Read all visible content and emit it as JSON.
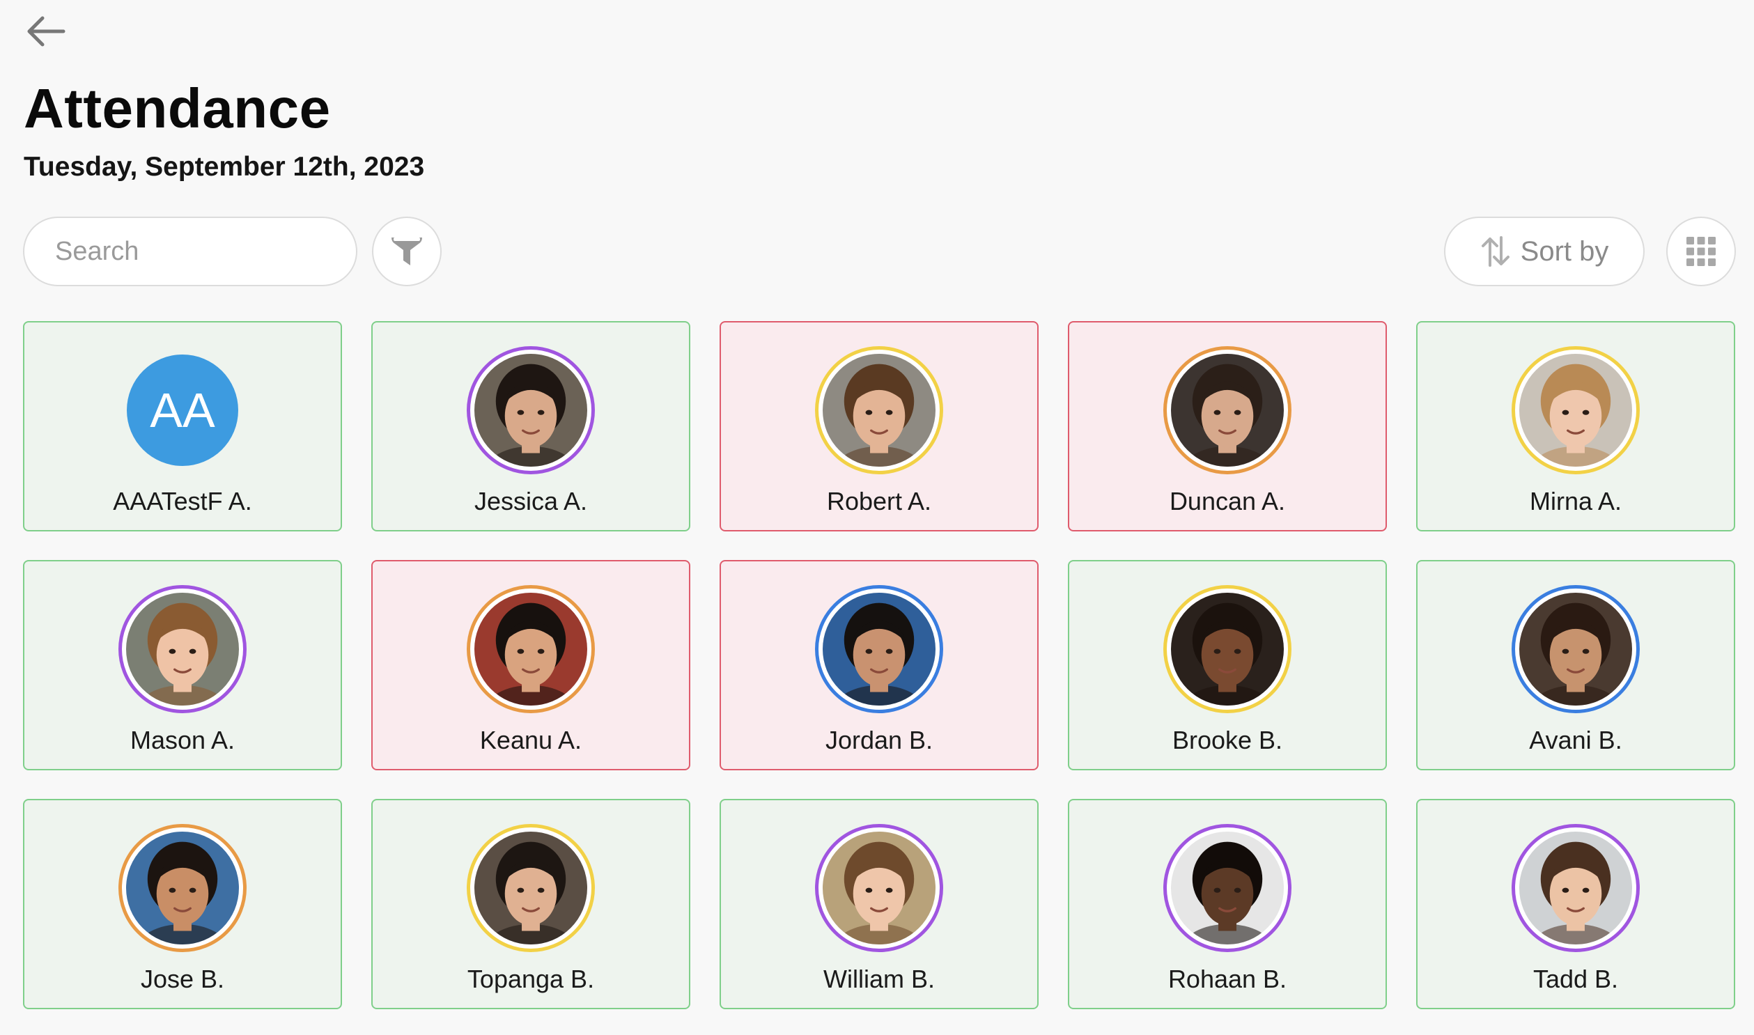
{
  "header": {
    "title": "Attendance",
    "date": "Tuesday, September 12th, 2023"
  },
  "toolbar": {
    "search_placeholder": "Search",
    "sort_label": "Sort by"
  },
  "colors": {
    "present_border": "#7fcf8a",
    "present_bg": "#eef4ee",
    "absent_border": "#df5b6c",
    "absent_bg": "#faebee",
    "ring_purple": "#a055e0",
    "ring_yellow": "#f2d146",
    "ring_orange": "#e89a45",
    "ring_blue": "#3a7ee0",
    "initials_bg": "#3d9be0"
  },
  "students": [
    {
      "name": "AAATestF A.",
      "status": "present",
      "initials": "AA"
    },
    {
      "name": "Jessica A.",
      "status": "present",
      "ring": "#a055e0",
      "skin": "#d9a98a",
      "hair": "#1e1612",
      "bg": "#6b6256"
    },
    {
      "name": "Robert A.",
      "status": "absent",
      "ring": "#f2d146",
      "skin": "#e3b495",
      "hair": "#5a3a22",
      "bg": "#8e8a82"
    },
    {
      "name": "Duncan A.",
      "status": "absent",
      "ring": "#e89a45",
      "skin": "#d7a98c",
      "hair": "#2b1f18",
      "bg": "#3c3430"
    },
    {
      "name": "Mirna A.",
      "status": "present",
      "ring": "#f2d146",
      "skin": "#efc7ad",
      "hair": "#b98a55",
      "bg": "#c9c2b8"
    },
    {
      "name": "Mason A.",
      "status": "present",
      "ring": "#a055e0",
      "skin": "#efc3a6",
      "hair": "#8a5b32",
      "bg": "#7b7f73"
    },
    {
      "name": "Keanu A.",
      "status": "absent",
      "ring": "#e89a45",
      "skin": "#d9a37f",
      "hair": "#17110e",
      "bg": "#9a3a2e"
    },
    {
      "name": "Jordan B.",
      "status": "absent",
      "ring": "#3a7ee0",
      "skin": "#c99270",
      "hair": "#15110f",
      "bg": "#2f5f9a"
    },
    {
      "name": "Brooke B.",
      "status": "present",
      "ring": "#f2d146",
      "skin": "#7a4a30",
      "hair": "#1b120d",
      "bg": "#2a211c"
    },
    {
      "name": "Avani B.",
      "status": "present",
      "ring": "#3a7ee0",
      "skin": "#c7936e",
      "hair": "#2a1a12",
      "bg": "#4a3a30"
    },
    {
      "name": "Jose B.",
      "status": "present",
      "ring": "#e89a45",
      "skin": "#c98e66",
      "hair": "#1c1410",
      "bg": "#3e6fa3"
    },
    {
      "name": "Topanga B.",
      "status": "present",
      "ring": "#f2d146",
      "skin": "#e0b192",
      "hair": "#1d1612",
      "bg": "#5a4e44"
    },
    {
      "name": "William B.",
      "status": "present",
      "ring": "#a055e0",
      "skin": "#efc6aa",
      "hair": "#6e4a2c",
      "bg": "#b8a27a"
    },
    {
      "name": "Rohaan B.",
      "status": "present",
      "ring": "#a055e0",
      "skin": "#5c3a26",
      "hair": "#120c09",
      "bg": "#e6e6e6"
    },
    {
      "name": "Tadd B.",
      "status": "present",
      "ring": "#a055e0",
      "skin": "#ecc3a5",
      "hair": "#4a3020",
      "bg": "#cfd2d4"
    }
  ]
}
